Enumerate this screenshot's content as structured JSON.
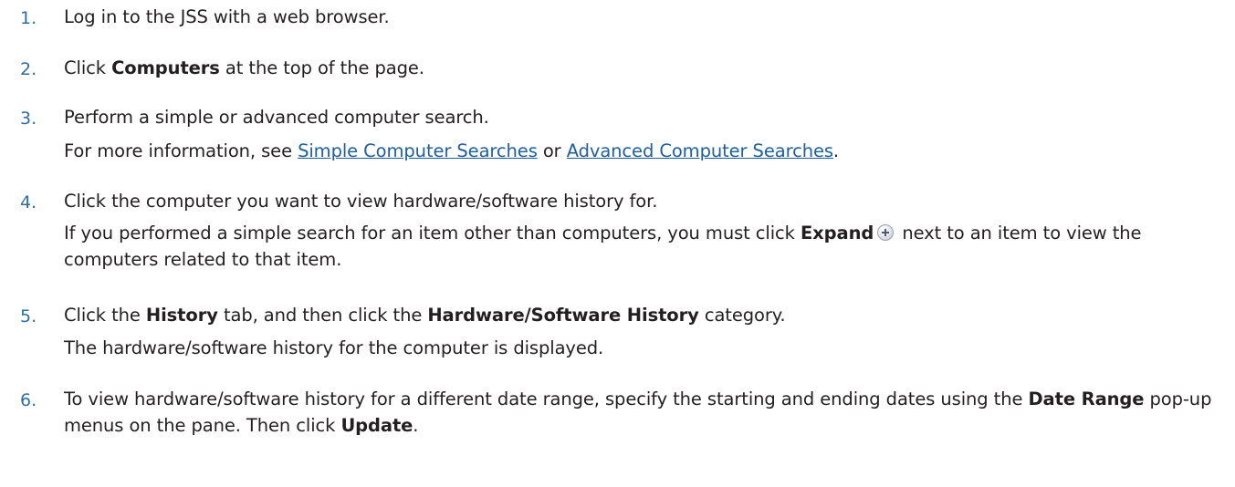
{
  "steps": [
    {
      "number": "1.",
      "text": "Log in to the JSS with a web browser."
    },
    {
      "number": "2.",
      "pre": "Click ",
      "bold": "Computers",
      "post": " at the top of the page."
    },
    {
      "number": "3.",
      "text": "Perform a simple or advanced computer search.",
      "note_pre": "For more information, see ",
      "link1": "Simple Computer Searches",
      "note_mid": " or ",
      "link2": "Advanced Computer Searches",
      "note_post": "."
    },
    {
      "number": "4.",
      "text": "Click the computer you want to view hardware/software history for.",
      "note_pre": "If you performed a simple search for an item other than computers, you must click ",
      "note_bold": "Expand",
      "note_icon": "plus-icon",
      "note_post": " next to an item to view the computers related to that item."
    },
    {
      "number": "5.",
      "pre": "Click the ",
      "bold1": "History",
      "mid": " tab, and then click the ",
      "bold2": "Hardware/Software History",
      "post": " category.",
      "note": "The hardware/software history for the computer is displayed."
    },
    {
      "number": "6.",
      "pre": "To view hardware/software history for a different date range, specify the starting and ending dates using the ",
      "bold1": "Date Range",
      "mid": " pop-up menus on the pane. Then click ",
      "bold2": "Update",
      "post": "."
    }
  ],
  "colors": {
    "number": "#2f6ea4",
    "link": "#1f5f9c",
    "text": "#231f20"
  }
}
